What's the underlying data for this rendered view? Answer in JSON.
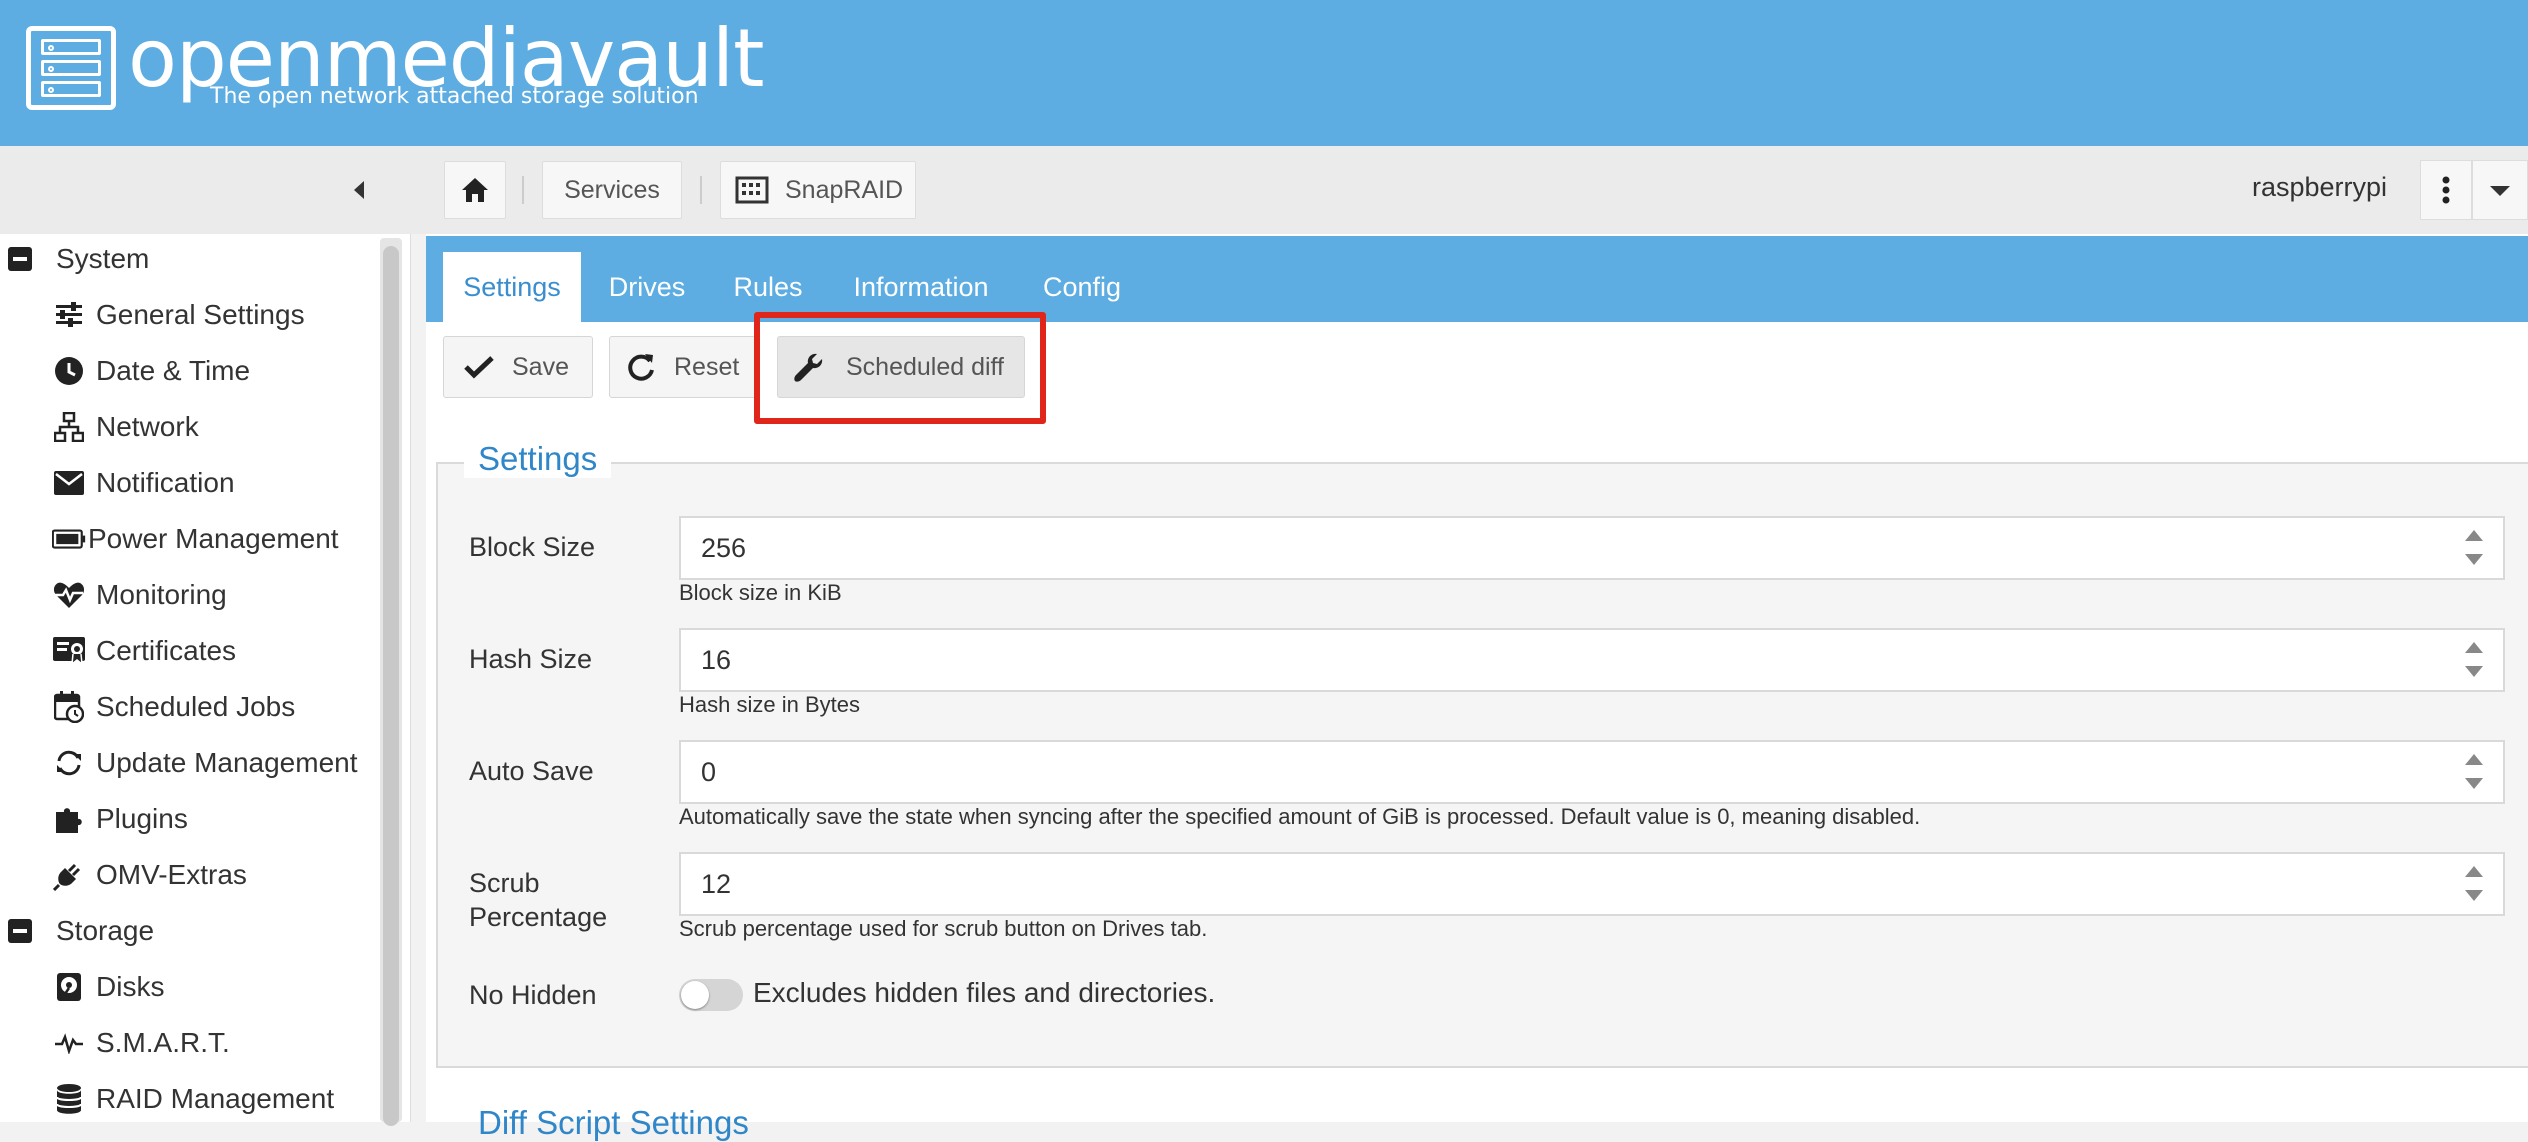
{
  "header": {
    "title": "openmediavault",
    "subtitle": "The open network attached storage solution"
  },
  "toolbar": {
    "breadcrumbs": [
      "Services",
      "SnapRAID"
    ],
    "hostname": "raspberrypi"
  },
  "sidebar": {
    "categories": [
      {
        "label": "System",
        "items": [
          {
            "label": "General Settings",
            "icon": "sliders-icon"
          },
          {
            "label": "Date & Time",
            "icon": "clock-icon"
          },
          {
            "label": "Network",
            "icon": "network-icon"
          },
          {
            "label": "Notification",
            "icon": "envelope-icon"
          },
          {
            "label": "Power Management",
            "icon": "battery-icon"
          },
          {
            "label": "Monitoring",
            "icon": "heartbeat-icon"
          },
          {
            "label": "Certificates",
            "icon": "certificate-icon"
          },
          {
            "label": "Scheduled Jobs",
            "icon": "calendar-clock-icon"
          },
          {
            "label": "Update Management",
            "icon": "refresh-icon"
          },
          {
            "label": "Plugins",
            "icon": "puzzle-icon"
          },
          {
            "label": "OMV-Extras",
            "icon": "plug-icon"
          }
        ]
      },
      {
        "label": "Storage",
        "items": [
          {
            "label": "Disks",
            "icon": "disk-icon"
          },
          {
            "label": "S.M.A.R.T.",
            "icon": "pulse-icon"
          },
          {
            "label": "RAID Management",
            "icon": "database-icon"
          }
        ]
      }
    ]
  },
  "tabs": [
    "Settings",
    "Drives",
    "Rules",
    "Information",
    "Config"
  ],
  "actions": {
    "save": "Save",
    "reset": "Reset",
    "scheduled_diff": "Scheduled diff"
  },
  "settings": {
    "legend": "Settings",
    "fields": [
      {
        "label": "Block Size",
        "value": "256",
        "hint": "Block size in KiB"
      },
      {
        "label": "Hash Size",
        "value": "16",
        "hint": "Hash size in Bytes"
      },
      {
        "label": "Auto Save",
        "value": "0",
        "hint": "Automatically save the state when syncing after the specified amount of GiB is processed. Default value is 0, meaning disabled."
      },
      {
        "label": "Scrub\nPercentage",
        "value": "12",
        "hint": "Scrub percentage used for scrub button on Drives tab."
      }
    ],
    "no_hidden": {
      "label": "No Hidden",
      "description": "Excludes hidden files and directories.",
      "enabled": false
    }
  },
  "diff_section_legend": "Diff Script Settings",
  "colors": {
    "header": "#5dade2",
    "accent": "#2f86c8",
    "highlight": "#e0261b"
  }
}
